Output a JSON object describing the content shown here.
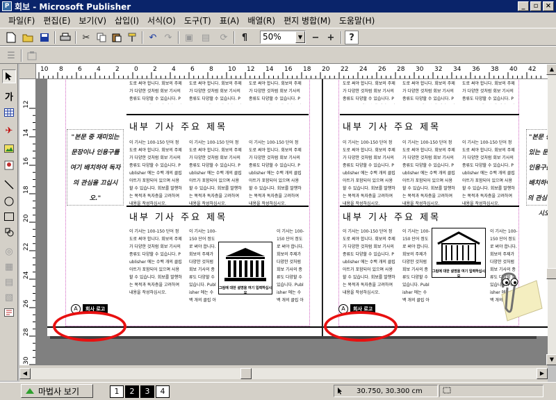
{
  "app": {
    "title": "회보 - Microsoft Publisher",
    "icon": "publisher-app-icon"
  },
  "window_buttons": [
    "minimize",
    "restore",
    "close"
  ],
  "menu": {
    "items": [
      "파일(F)",
      "편집(E)",
      "보기(V)",
      "삽입(I)",
      "서식(O)",
      "도구(T)",
      "표(A)",
      "배열(R)",
      "편지 병합(M)",
      "도움말(H)"
    ]
  },
  "toolbar": {
    "zoom_value": "50%",
    "zoom_minus": "−",
    "zoom_plus": "+",
    "paragraph_mark": "¶",
    "help": "?"
  },
  "left_tools": [
    "pointer-tool",
    "text-frame-tool",
    "table-frame-tool",
    "wordart-frame-tool",
    "picture-frame-tool",
    "clip-gallery-tool",
    "line-tool",
    "oval-tool",
    "rectangle-tool",
    "custom-shapes-tool",
    "design-gallery-object",
    "object-tool",
    "form-control-tool",
    "html-code-tool",
    "hotspot-tool"
  ],
  "ruler": {
    "h_labels": [
      "10",
      "8",
      "6",
      "4",
      "2",
      "0",
      "2",
      "4",
      "6",
      "8",
      "10",
      "12",
      "14",
      "16",
      "18",
      "20",
      "22",
      "24",
      "26",
      "28",
      "30",
      "32",
      "34",
      "36",
      "38",
      "40",
      "42"
    ],
    "v_labels": [
      "12",
      "14",
      "16",
      "18",
      "20",
      "22",
      "24",
      "26",
      "28",
      "30"
    ]
  },
  "document": {
    "heading1": "내부 기사 주요 제목",
    "heading2": "내부 기사 주요 제목",
    "quote": "\"본문 중 재미있는 문장이나 인용구를 여기 배치하여 독자의 관심을 끄십시오.\"",
    "body_text": "이 기사는 100-150 단어 정도로 써야 합니다. 회보의 주제가 다양한 것처럼 회보 기사의 종류도 다양할 수 있습니다. Publisher 에는 수백 개의 클립 아트가 포함되어 있으며 사용할 수 있습니다. 회보를 발행하는 목적과 독자층을 고려하여 내용을 작성하십시오.",
    "caption": "그림에 대한 설명을 여기 입력하십시오",
    "logo_text": "회사 로고",
    "logo_mark": "A"
  },
  "status": {
    "wizard_button": "마법사 보기",
    "pages": [
      "1",
      "2",
      "3",
      "4"
    ],
    "current_pages": [
      "2",
      "3"
    ],
    "coordinates": "30.750, 30.300 cm"
  },
  "colors": {
    "titlebar": "#0a246a",
    "face": "#d4d0c8",
    "workspace": "#808080",
    "highlight_circle": "#e81010"
  }
}
